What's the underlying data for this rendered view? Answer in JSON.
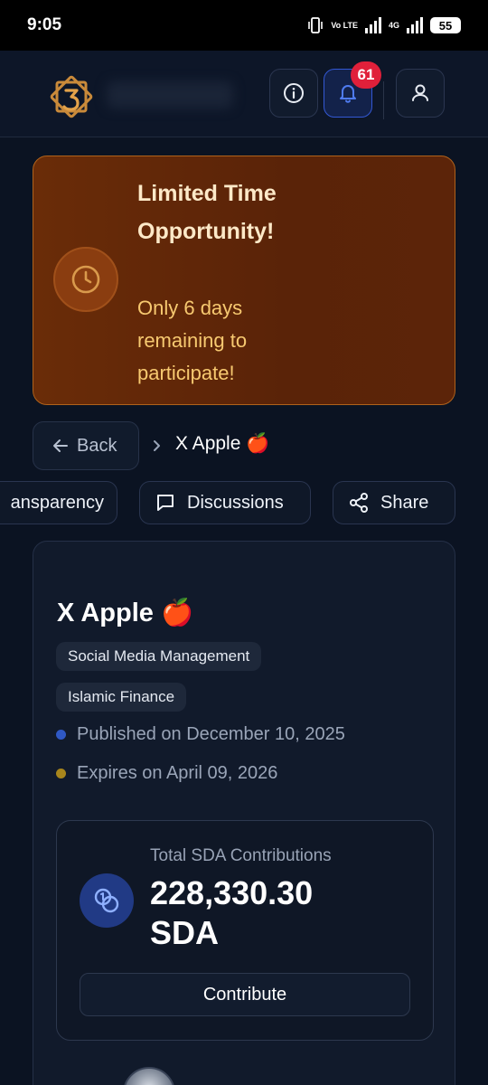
{
  "status_bar": {
    "time": "9:05",
    "network_label": "Vo LTE",
    "network_4g": "4G",
    "battery": "55"
  },
  "header": {
    "logo_icon": "star-logo-icon",
    "notification_count": "61",
    "accent": "#3358d4"
  },
  "banner": {
    "title": "Limited Time Opportunity!",
    "subtitle": "Only 6 days remaining to participate!",
    "icon": "clock-icon"
  },
  "breadcrumb": {
    "back_label": "Back",
    "current": "X Apple 🍎"
  },
  "actions": {
    "transparency_label": "ansparency",
    "discussions_label": "Discussions",
    "share_label": "Share"
  },
  "project": {
    "title": "X Apple 🍎",
    "tags": [
      "Social Media Management",
      "Islamic Finance"
    ],
    "published": "Published on December 10, 2025",
    "expires": "Expires on April 09, 2026",
    "published_dot_color": "#2f58c4",
    "expires_dot_color": "#a8861c"
  },
  "contributions": {
    "label": "Total SDA Contributions",
    "amount": "228,330.30 SDA",
    "button_label": "Contribute"
  }
}
